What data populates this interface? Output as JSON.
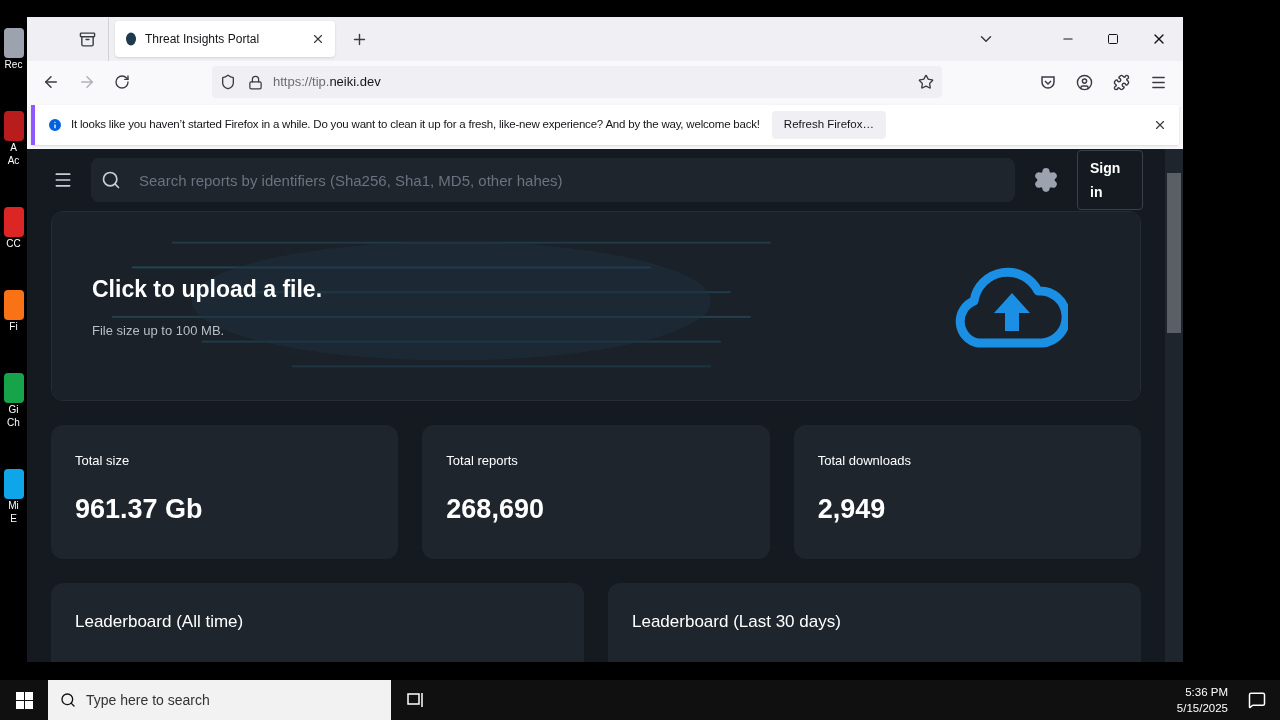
{
  "desktop_icons": [
    {
      "lines": [
        "Rec"
      ],
      "color": "#9ca3af"
    },
    {
      "lines": [
        "A",
        "Ac"
      ],
      "color": "#b91c1c"
    },
    {
      "lines": [
        "CC"
      ],
      "color": "#dc2626"
    },
    {
      "lines": [
        "Fi"
      ],
      "color": "#f97316"
    },
    {
      "lines": [
        "Gi",
        "Ch"
      ],
      "color": "#16a34a"
    },
    {
      "lines": [
        "Mi",
        "E"
      ],
      "color": "#0ea5e9"
    }
  ],
  "browser": {
    "tab": {
      "title": "Threat Insights Portal",
      "selected": true
    },
    "url_prefix": "https://tip.",
    "url_domain": "neiki.dev",
    "notification": {
      "message": "It looks like you haven’t started Firefox in a while. Do you want to clean it up for a fresh, like-new experience? And by the way, welcome back!",
      "button": "Refresh Firefox…"
    }
  },
  "page": {
    "search": {
      "placeholder": "Search reports by identifiers (Sha256, Sha1, MD5, other hahes)"
    },
    "sign_in": "Sign in",
    "upload": {
      "title": "Click to upload a file.",
      "subtitle": "File size up to 100 MB."
    },
    "stats": [
      {
        "label": "Total size",
        "value": "961.37 Gb"
      },
      {
        "label": "Total reports",
        "value": "268,690"
      },
      {
        "label": "Total downloads",
        "value": "2,949"
      }
    ],
    "leaderboards": [
      {
        "title": "Leaderboard (All time)"
      },
      {
        "title": "Leaderboard (Last 30 days)"
      }
    ]
  },
  "taskbar": {
    "search_placeholder": "Type here to search",
    "time": "5:36 PM",
    "date": "5/15/2025"
  }
}
